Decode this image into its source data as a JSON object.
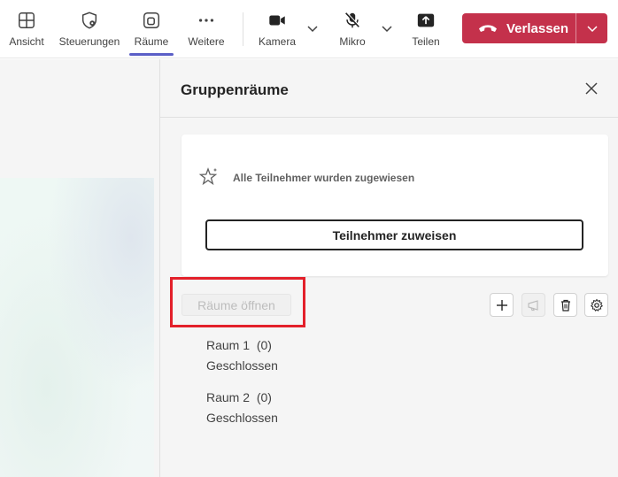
{
  "toolbar": {
    "view_label": "Ansicht",
    "controls_label": "Steuerungen",
    "rooms_label": "Räume",
    "more_label": "Weitere",
    "camera_label": "Kamera",
    "mic_label": "Mikro",
    "share_label": "Teilen",
    "leave_label": "Verlassen",
    "active_tab": "Räume",
    "accent_color": "#5b5fc7",
    "leave_color": "#c4314b"
  },
  "panel": {
    "title": "Gruppenräume",
    "status_text": "Alle Teilnehmer wurden zugewiesen",
    "assign_button": "Teilnehmer zuweisen",
    "open_rooms_button": "Räume öffnen",
    "action_icons": [
      "add-icon",
      "announcement-icon",
      "delete-icon",
      "settings-icon"
    ],
    "rooms": [
      {
        "name": "Raum 1",
        "count": "(0)",
        "status": "Geschlossen"
      },
      {
        "name": "Raum 2",
        "count": "(0)",
        "status": "Geschlossen"
      }
    ]
  },
  "highlight_color": "#e3202a"
}
